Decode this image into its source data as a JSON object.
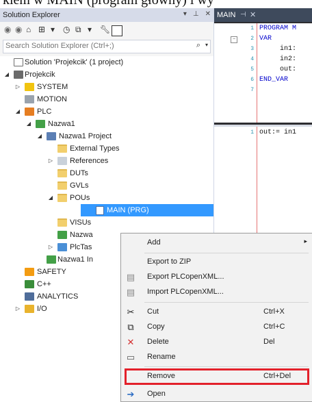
{
  "caption": "kiem w MAIN (program główny) i wy",
  "solution_explorer": {
    "title": "Solution Explorer",
    "title_buttons": [
      "▾",
      "⊥",
      "✕"
    ],
    "toolbar_icons": [
      "back-icon",
      "forward-icon",
      "home-icon",
      "solution-view-icon",
      "history-icon",
      "sync-icon",
      "properties-icon",
      "preview-icon"
    ],
    "search_placeholder": "Search Solution Explorer (Ctrl+;)",
    "tree": [
      {
        "label": "Solution 'Projekcik' (1 project)",
        "icon": "solution-icon"
      },
      {
        "label": "Projekcik",
        "icon": "project-icon"
      },
      {
        "label": "SYSTEM",
        "icon": "system-icon"
      },
      {
        "label": "MOTION",
        "icon": "motion-icon"
      },
      {
        "label": "PLC",
        "icon": "plc-icon"
      },
      {
        "label": "Nazwa1",
        "icon": "plc-project-icon"
      },
      {
        "label": "Nazwa1 Project",
        "icon": "plc-subproject-icon"
      },
      {
        "label": "External Types",
        "icon": "folder-icon"
      },
      {
        "label": "References",
        "icon": "references-icon"
      },
      {
        "label": "DUTs",
        "icon": "folder-icon"
      },
      {
        "label": "GVLs",
        "icon": "folder-icon"
      },
      {
        "label": "POUs",
        "icon": "folder-open-icon"
      },
      {
        "label": "MAIN (PRG)",
        "icon": "program-icon"
      },
      {
        "label": "VISUs",
        "icon": "folder-icon"
      },
      {
        "label": "Nazwa",
        "icon": "task-icon"
      },
      {
        "label": "PlcTas",
        "icon": "plctask-icon"
      },
      {
        "label": "Nazwa1 In",
        "icon": "instance-icon"
      },
      {
        "label": "SAFETY",
        "icon": "safety-icon"
      },
      {
        "label": "C++",
        "icon": "cpp-icon"
      },
      {
        "label": "ANALYTICS",
        "icon": "analytics-icon"
      },
      {
        "label": "I/O",
        "icon": "io-icon"
      }
    ]
  },
  "editor": {
    "tab_label": "MAIN",
    "tab_pin": "⊣",
    "tab_close": "✕",
    "decl_lines": [
      {
        "num": "1",
        "text": "PROGRAM M"
      },
      {
        "num": "2",
        "text": "VAR"
      },
      {
        "num": "3",
        "text": "in1:"
      },
      {
        "num": "4",
        "text": "in2:"
      },
      {
        "num": "5",
        "text": "out:"
      },
      {
        "num": "6",
        "text": "END_VAR"
      },
      {
        "num": "7",
        "text": ""
      }
    ],
    "body_lines": [
      {
        "num": "1",
        "text": "out:= in1"
      }
    ]
  },
  "context_menu": {
    "items": [
      {
        "label": "Add",
        "shortcut": "",
        "icon": "",
        "submenu": "▸"
      },
      {
        "label": "Export to ZIP",
        "shortcut": "",
        "icon": ""
      },
      {
        "label": "Export PLCopenXML...",
        "shortcut": "",
        "icon": "export-xml-icon"
      },
      {
        "label": "Import PLCopenXML...",
        "shortcut": "",
        "icon": "import-xml-icon"
      },
      {
        "label": "Cut",
        "shortcut": "Ctrl+X",
        "icon": "scissors-icon"
      },
      {
        "label": "Copy",
        "shortcut": "Ctrl+C",
        "icon": "copy-icon"
      },
      {
        "label": "Delete",
        "shortcut": "Del",
        "icon": "delete-icon"
      },
      {
        "label": "Rename",
        "shortcut": "",
        "icon": "rename-icon"
      },
      {
        "label": "Remove",
        "shortcut": "Ctrl+Del",
        "icon": ""
      },
      {
        "label": "Open",
        "shortcut": "",
        "icon": "open-icon"
      }
    ]
  },
  "colors": {
    "selection": "#3399ff",
    "highlight_box": "#e3212b",
    "title_bar": "#d6dbe9",
    "editor_dark": "#2d2d30"
  }
}
